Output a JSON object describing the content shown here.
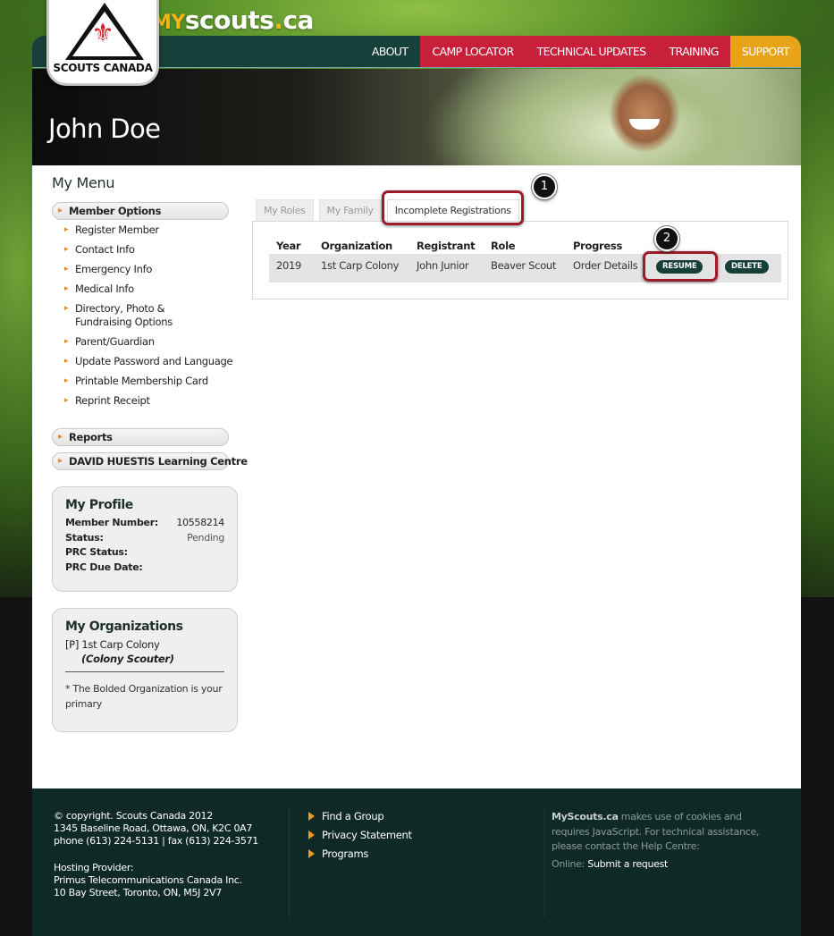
{
  "brand": {
    "prefix": "MY",
    "name": "scouts",
    "dot": ".",
    "tld": "ca",
    "logo_text": "SCOUTS CANADA"
  },
  "nav": {
    "items": [
      {
        "label": "ABOUT"
      },
      {
        "label": "CAMP LOCATOR"
      },
      {
        "label": "TECHNICAL UPDATES"
      },
      {
        "label": "TRAINING"
      },
      {
        "label": "SUPPORT"
      }
    ]
  },
  "hero": {
    "title": "John Doe"
  },
  "sidebar": {
    "title": "My Menu",
    "member_options": "Member Options",
    "items": [
      {
        "label": "Register Member"
      },
      {
        "label": "Contact Info"
      },
      {
        "label": "Emergency Info"
      },
      {
        "label": "Medical Info"
      },
      {
        "label": "Directory, Photo & Fundraising Options"
      },
      {
        "label": "Parent/Guardian"
      },
      {
        "label": "Update Password and Language"
      },
      {
        "label": "Printable Membership Card"
      },
      {
        "label": "Reprint Receipt"
      }
    ],
    "reports": "Reports",
    "learning": "DAVID HUESTIS Learning Centre"
  },
  "profile": {
    "title": "My Profile",
    "rows": [
      {
        "k": "Member Number:",
        "v": "10558214"
      },
      {
        "k": "Status:",
        "v": "Pending"
      },
      {
        "k": "PRC Status:",
        "v": ""
      },
      {
        "k": "PRC Due Date:",
        "v": ""
      }
    ]
  },
  "orgs": {
    "title": "My Organizations",
    "name": "[P] 1st Carp Colony",
    "role": "(Colony Scouter)",
    "note": "* The Bolded Organization is your primary"
  },
  "tabs": [
    {
      "label": "My Roles"
    },
    {
      "label": "My Family"
    },
    {
      "label": "Incomplete Registrations"
    }
  ],
  "table": {
    "headers": [
      "Year",
      "Organization",
      "Registrant",
      "Role",
      "Progress"
    ],
    "row": {
      "year": "2019",
      "org": "1st Carp Colony",
      "registrant": "John Junior",
      "role": "Beaver Scout",
      "progress": "Order Details"
    },
    "resume": "RESUME",
    "delete": "DELETE"
  },
  "annotations": {
    "one": "1",
    "two": "2"
  },
  "footer": {
    "copyright": "© copyright. Scouts Canada 2012",
    "address": "1345 Baseline Road, Ottawa, ON, K2C 0A7",
    "phone": "phone (613) 224-5131 | fax (613) 224-3571",
    "hosting_label": "Hosting Provider:",
    "hosting_name": "Primus Telecommunications Canada Inc.",
    "hosting_address": "10 Bay Street, Toronto, ON, M5J 2V7",
    "links": [
      {
        "label": "Find a Group"
      },
      {
        "label": "Privacy Statement"
      },
      {
        "label": "Programs"
      }
    ],
    "note_brand": "MyScouts.ca",
    "note_line1": " makes use of cookies and",
    "note_line2": "requires JavaScript. For technical assistance,",
    "note_line3": "please contact the Help Centre:",
    "online_label": "Online:",
    "online_link": "Submit a request"
  },
  "colors": {
    "nav_bg": "#17403a",
    "nav_red": "#c8203a",
    "nav_support": "#e8a418",
    "accent_orange": "#e48a2a",
    "highlight": "#9e1b2a",
    "footer_bg": "#0f2a26"
  }
}
